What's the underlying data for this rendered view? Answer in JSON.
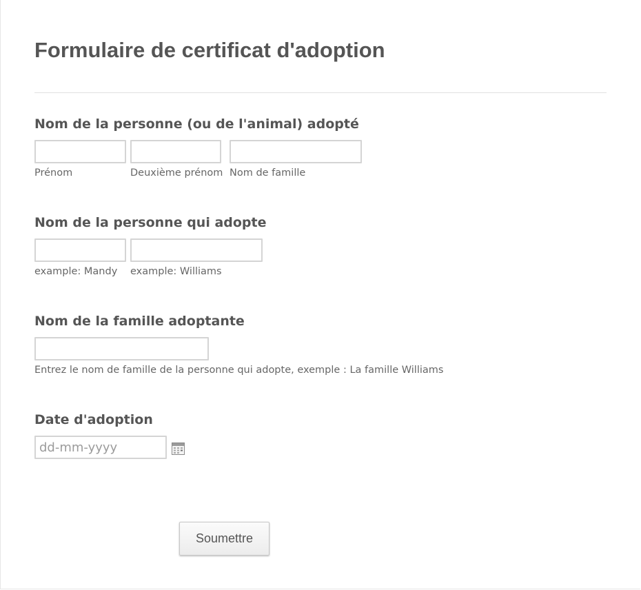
{
  "form": {
    "title": "Formulaire de certificat d'adoption",
    "submit_label": "Soumettre"
  },
  "fields": {
    "adopted_name": {
      "label": "Nom de la personne (ou de l'animal) adopté",
      "sublabels": {
        "first": "Prénom",
        "middle": "Deuxième prénom",
        "last": "Nom de famille"
      },
      "values": {
        "first": "",
        "middle": "",
        "last": ""
      }
    },
    "adopter_name": {
      "label": "Nom de la personne qui adopte",
      "sublabels": {
        "first": "example: Mandy",
        "last": "example: Williams"
      },
      "values": {
        "first": "",
        "last": ""
      }
    },
    "family_name": {
      "label": "Nom de la famille adoptante",
      "hint": "Entrez le nom de famille de la personne qui adopte, exemple : La famille Williams",
      "value": ""
    },
    "adoption_date": {
      "label": "Date d'adoption",
      "placeholder": "dd-mm-yyyy",
      "value": "",
      "icon": "calendar-icon"
    }
  },
  "colors": {
    "text": "#555555",
    "input_border": "#d4d4d4",
    "divider": "#e0e0e0"
  }
}
